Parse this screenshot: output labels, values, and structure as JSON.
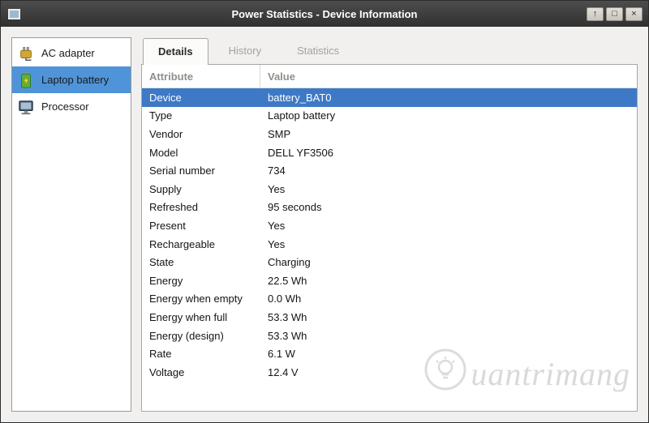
{
  "window": {
    "title": "Power Statistics - Device Information",
    "controls": [
      {
        "name": "shade-button",
        "glyph": "↑"
      },
      {
        "name": "maximize-button",
        "glyph": "□"
      },
      {
        "name": "close-button",
        "glyph": "×"
      }
    ]
  },
  "sidebar": {
    "items": [
      {
        "label": "AC adapter",
        "icon": "ac-adapter-icon",
        "selected": false
      },
      {
        "label": "Laptop battery",
        "icon": "battery-icon",
        "selected": true
      },
      {
        "label": "Processor",
        "icon": "processor-icon",
        "selected": false
      }
    ]
  },
  "tabs": [
    {
      "label": "Details",
      "active": true,
      "enabled": true
    },
    {
      "label": "History",
      "active": false,
      "enabled": false
    },
    {
      "label": "Statistics",
      "active": false,
      "enabled": false
    }
  ],
  "table": {
    "columns": [
      "Attribute",
      "Value"
    ],
    "rows": [
      {
        "attribute": "Device",
        "value": "battery_BAT0",
        "selected": true
      },
      {
        "attribute": "Type",
        "value": "Laptop battery",
        "selected": false
      },
      {
        "attribute": "Vendor",
        "value": "SMP",
        "selected": false
      },
      {
        "attribute": "Model",
        "value": "DELL YF3506",
        "selected": false
      },
      {
        "attribute": "Serial number",
        "value": "734",
        "selected": false
      },
      {
        "attribute": "Supply",
        "value": "Yes",
        "selected": false
      },
      {
        "attribute": "Refreshed",
        "value": "95 seconds",
        "selected": false
      },
      {
        "attribute": "Present",
        "value": "Yes",
        "selected": false
      },
      {
        "attribute": "Rechargeable",
        "value": "Yes",
        "selected": false
      },
      {
        "attribute": "State",
        "value": "Charging",
        "selected": false
      },
      {
        "attribute": "Energy",
        "value": "22.5 Wh",
        "selected": false
      },
      {
        "attribute": "Energy when empty",
        "value": "0.0 Wh",
        "selected": false
      },
      {
        "attribute": "Energy when full",
        "value": "53.3 Wh",
        "selected": false
      },
      {
        "attribute": "Energy (design)",
        "value": "53.3 Wh",
        "selected": false
      },
      {
        "attribute": "Rate",
        "value": "6.1 W",
        "selected": false
      },
      {
        "attribute": "Voltage",
        "value": "12.4 V",
        "selected": false
      }
    ]
  },
  "watermark": {
    "text": "uantrimang"
  },
  "colors": {
    "selection_blue": "#3d79c6",
    "sidebar_selection": "#4f94d9",
    "titlebar_dark": "#3a3a3a"
  }
}
